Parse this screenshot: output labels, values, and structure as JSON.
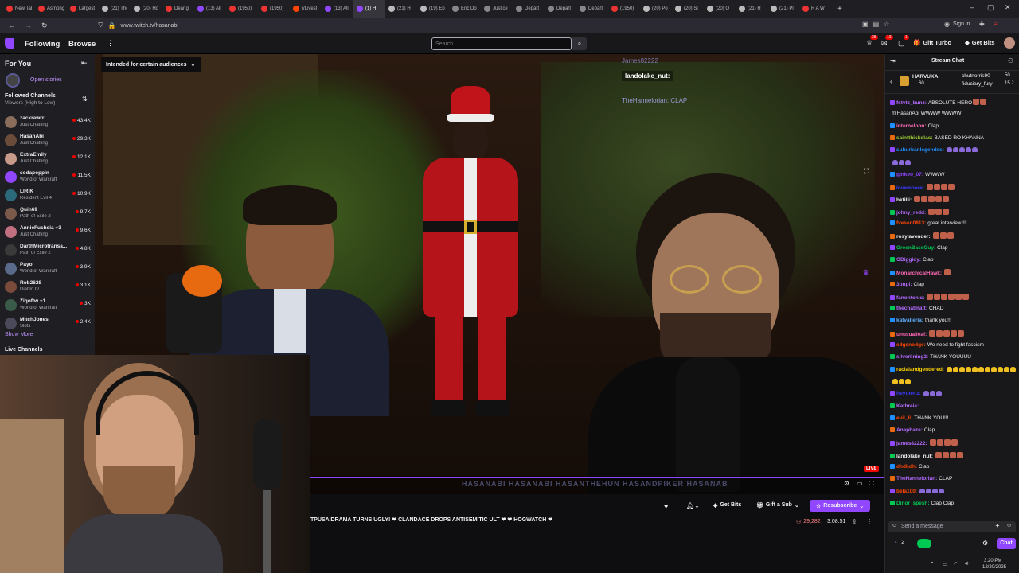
{
  "browser": {
    "tabs": [
      {
        "label": "New Tab",
        "color": "#e33"
      },
      {
        "label": "Asmongold",
        "color": "#e33"
      },
      {
        "label": "Largest",
        "color": "#e33"
      },
      {
        "label": "(21) The",
        "color": "#bbb"
      },
      {
        "label": "(20) Ho",
        "color": "#bbb"
      },
      {
        "label": "Dear g",
        "color": "#e33"
      },
      {
        "label": "(13) All",
        "color": "#9146ff"
      },
      {
        "label": "(1950)",
        "color": "#e33"
      },
      {
        "label": "(1950)",
        "color": "#e33"
      },
      {
        "label": "r/Livest",
        "color": "#ff4500"
      },
      {
        "label": "(13) All",
        "color": "#9146ff"
      },
      {
        "label": "(1) H",
        "color": "#9146ff"
      },
      {
        "label": "(21) H",
        "color": "#bbb"
      },
      {
        "label": "(19) Ep",
        "color": "#bbb"
      },
      {
        "label": "Eric Do",
        "color": "#888"
      },
      {
        "label": "Justice",
        "color": "#888"
      },
      {
        "label": "Depart",
        "color": "#888"
      },
      {
        "label": "Depart",
        "color": "#888"
      },
      {
        "label": "Depart",
        "color": "#888"
      },
      {
        "label": "(1950)",
        "color": "#e33"
      },
      {
        "label": "(20) Po",
        "color": "#bbb"
      },
      {
        "label": "(20) Si",
        "color": "#bbb"
      },
      {
        "label": "(20) Q",
        "color": "#bbb"
      },
      {
        "label": "(21) R",
        "color": "#bbb"
      },
      {
        "label": "(21) Pl",
        "color": "#bbb"
      },
      {
        "label": "R A W",
        "color": "#e33"
      }
    ],
    "new_tab": "+",
    "url": "www.twitch.tv/hasanabi",
    "sign_in": "Sign in"
  },
  "nav": {
    "following": "Following",
    "browse": "Browse",
    "more": "⋮",
    "search_placeholder": "Search",
    "notif_badge_1": "28",
    "notif_badge_2": "13",
    "notif_badge_3": "1",
    "gift_turbo": "Gift Turbo",
    "get_bits": "Get Bits"
  },
  "sidebar": {
    "for_you": "For You",
    "open_stories": "Open stories",
    "followed_title": "Followed Channels",
    "followed_sort": "Viewers (High to Low)",
    "channels": [
      {
        "name": "zackrawrr",
        "game": "Just Chatting",
        "viewers": "43.4K",
        "color": "#8a6d5a"
      },
      {
        "name": "HasanAbi",
        "game": "Just Chatting",
        "viewers": "29.3K",
        "color": "#6b4c3b"
      },
      {
        "name": "ExtraEmily",
        "game": "Just Chatting",
        "viewers": "12.1K",
        "color": "#c89a8a"
      },
      {
        "name": "sodapoppin",
        "game": "World of Warcraft",
        "viewers": "11.5K",
        "color": "#9146ff"
      },
      {
        "name": "LIRIK",
        "game": "Resident Evil 4",
        "viewers": "10.9K",
        "color": "#2a6a7a"
      },
      {
        "name": "Quin69",
        "game": "Path of Exile 2",
        "viewers": "9.7K",
        "color": "#7a5a4a"
      },
      {
        "name": "AnnieFuchsia +3",
        "game": "Just Chatting",
        "viewers": "9.6K",
        "color": "#c07080"
      },
      {
        "name": "DarthMicrotransa...",
        "game": "Path of Exile 2",
        "viewers": "4.8K",
        "color": "#3a3a3a"
      },
      {
        "name": "Payo",
        "game": "World of Warcraft",
        "viewers": "3.9K",
        "color": "#5a6a8a"
      },
      {
        "name": "Rob2628",
        "game": "Diablo IV",
        "viewers": "3.1K",
        "color": "#7a4a3a"
      },
      {
        "name": "Ziqoftw +1",
        "game": "World of Warcraft",
        "viewers": "3K",
        "color": "#3a5a4a"
      },
      {
        "name": "MitchJones",
        "game": "Slots",
        "viewers": "2.4K",
        "color": "#4a4a5a"
      }
    ],
    "show_more": "Show More",
    "live_channels": "Live Channels"
  },
  "video": {
    "audience_label": "Intended for certain audiences",
    "live_badge": "LIVE",
    "overlay_user1": "James82222",
    "overlay_user2": "landolake_nut:",
    "overlay_user3": "TheHannelorian: CLAP",
    "overlay_banner": "HASANABI  HASANABI  HASANTHEHUN  HASANDPIKER  HASANAB"
  },
  "info": {
    "ticker": "TPUSA DRAMA TURNS UGLY! ❤ CLANDACE DROPS ANTISEMITIC ULT ❤ ❤ HOGWATCH ❤",
    "viewers": "29,282",
    "uptime": "3:08:51",
    "get_bits": "Get Bits",
    "gift_sub": "Gift a Sub",
    "resubscribe": "Resubscribe"
  },
  "chat": {
    "header": "Stream Chat",
    "pinned": [
      {
        "user": "HARVUKA",
        "count": "60"
      },
      {
        "user": "chutnorris90",
        "count": "50"
      },
      {
        "user": "fiduciary_fury",
        "count": "15"
      }
    ],
    "messages": [
      {
        "user": "fstvtz_bunz:",
        "text": "ABSOLUTE HERO",
        "color": "#b56bff",
        "emotes": 2
      },
      {
        "user": "",
        "text": "@HasanAbi WWWW WWWW",
        "color": "#efeff1",
        "emotes": 0
      },
      {
        "user": "interneloon:",
        "text": "Clap",
        "color": "#ff69b4",
        "emotes": 0
      },
      {
        "user": "saintthickolas:",
        "text": "BASED RO KHANNA",
        "color": "#9acd32",
        "emotes": 0
      },
      {
        "user": "suburbanlegendss:",
        "text": "",
        "color": "#1e90ff",
        "emotes": 0,
        "hearts": 5
      },
      {
        "user": "",
        "text": "",
        "color": "#efeff1",
        "emotes": 0,
        "hearts": 3
      },
      {
        "user": "ginkeo_07:",
        "text": "WWWW",
        "color": "#9146ff",
        "emotes": 0
      },
      {
        "user": "lovemoore:",
        "text": "",
        "color": "#3a3aff",
        "emotes": 4
      },
      {
        "user": "bktilli:",
        "text": "",
        "color": "#efeff1",
        "emotes": 5
      },
      {
        "user": "johny_redd:",
        "text": "",
        "color": "#b56bff",
        "emotes": 3
      },
      {
        "user": "fvesen0813:",
        "text": "great interview!!!!",
        "color": "#ff4500",
        "emotes": 0
      },
      {
        "user": "rosylavender:",
        "text": "",
        "color": "#efeff1",
        "emotes": 3
      },
      {
        "user": "GreenBassGuy:",
        "text": "Clap",
        "color": "#00c853",
        "emotes": 0
      },
      {
        "user": "ODiggidy:",
        "text": "Clap",
        "color": "#b56bff",
        "emotes": 0
      },
      {
        "user": "MonarchicalHawk:",
        "text": "",
        "color": "#ff69b4",
        "emotes": 1
      },
      {
        "user": "3tmpl:",
        "text": "Clap",
        "color": "#b56bff",
        "emotes": 0
      },
      {
        "user": "fanontonic:",
        "text": "",
        "color": "#b56bff",
        "emotes": 6
      },
      {
        "user": "thechatmatt:",
        "text": "CHAD",
        "color": "#b56bff",
        "emotes": 0
      },
      {
        "user": "katvalleria:",
        "text": "thank you!!",
        "color": "#5fb0ff",
        "emotes": 0
      },
      {
        "user": "unusualleaf:",
        "text": "",
        "color": "#ff69b4",
        "emotes": 5
      },
      {
        "user": "edgenodge:",
        "text": "We need to fight fascism",
        "color": "#ff4500",
        "emotes": 0
      },
      {
        "user": "silverlining2:",
        "text": "THANK YOUUUU",
        "color": "#b56bff",
        "emotes": 0
      },
      {
        "user": "racialandgendered:",
        "text": "",
        "color": "#ffd400",
        "emotes": 0,
        "yhearts": 12
      },
      {
        "user": "",
        "text": "",
        "color": "#efeff1",
        "emotes": 0,
        "yhearts": 3
      },
      {
        "user": "heytheriz:",
        "text": "",
        "color": "#3a3aff",
        "emotes": 0,
        "hearts": 3
      },
      {
        "user": "Kathreia:",
        "text": "",
        "color": "#b56bff",
        "emotes": 0
      },
      {
        "user": "evil_li:",
        "text": "THANK YOU!!!",
        "color": "#ff4500",
        "emotes": 0
      },
      {
        "user": "Anaphaze:",
        "text": "Clap",
        "color": "#b56bff",
        "emotes": 0
      },
      {
        "user": "james82222:",
        "text": "",
        "color": "#b56bff",
        "emotes": 4
      },
      {
        "user": "landolake_nut:",
        "text": "",
        "color": "#efeff1",
        "emotes": 4
      },
      {
        "user": "dhdhdh:",
        "text": "Clap",
        "color": "#ff4500",
        "emotes": 0
      },
      {
        "user": "TheHannelorian:",
        "text": "CLAP",
        "color": "#b56bff",
        "emotes": 0
      },
      {
        "user": "bela100:",
        "text": "",
        "color": "#ff4500",
        "emotes": 0,
        "hearts": 4
      },
      {
        "user": "Dinor_spesh:",
        "text": "Clap Clap",
        "color": "#00c853",
        "emotes": 0
      }
    ],
    "input_placeholder": "Send a message",
    "points": "2",
    "chat_button": "Chat"
  },
  "taskbar": {
    "time": "3:20 PM",
    "date": "12/20/2025"
  }
}
